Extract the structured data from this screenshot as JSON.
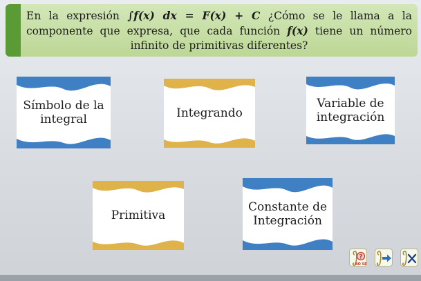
{
  "question": {
    "part1": "En la expresión ",
    "math_integral": "∫f(x) dx = F(x) + C",
    "part2": " ¿Cómo se le llama a la componente que expresa, que cada función ",
    "math_f": "f(x)",
    "part3": " tiene un número infinito de primitivas diferentes?"
  },
  "options": {
    "simbolo": {
      "line1": "Símbolo de la",
      "line2": "integral"
    },
    "integrando": {
      "line1": "Integrando"
    },
    "variable": {
      "line1": "Variable de",
      "line2": "integración"
    },
    "primitiva": {
      "line1": "Primitiva"
    },
    "constante": {
      "line1": "Constante de",
      "line2": "Integración"
    }
  },
  "footer": {
    "no_se_label": "NO SÉ"
  },
  "colors": {
    "card_blue": "#3f7fc3",
    "card_gold": "#e0b24a",
    "question_bg": "#c6de9f",
    "question_accent": "#5a9b35"
  },
  "icons": [
    "no-se-help-icon",
    "next-arrow-icon",
    "close-x-icon"
  ]
}
